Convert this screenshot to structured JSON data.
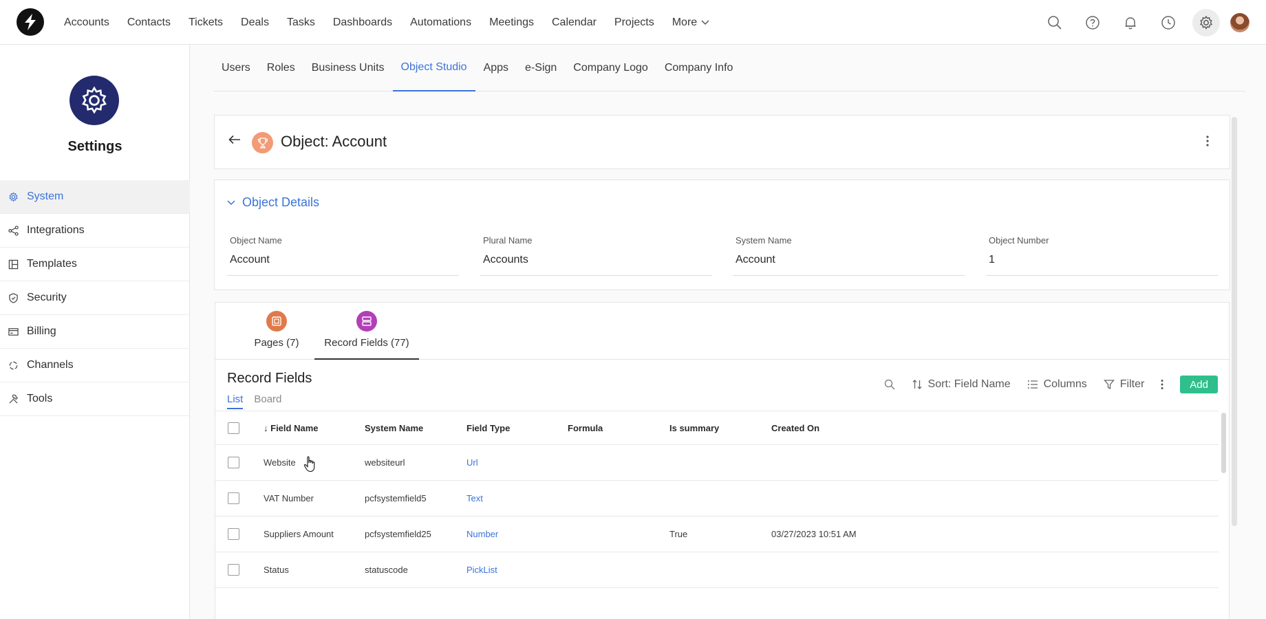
{
  "topnav": {
    "items": [
      "Accounts",
      "Contacts",
      "Tickets",
      "Deals",
      "Tasks",
      "Dashboards",
      "Automations",
      "Meetings",
      "Calendar",
      "Projects"
    ],
    "more_label": "More"
  },
  "sidebar": {
    "title": "Settings",
    "items": [
      {
        "label": "System",
        "icon": "gear-icon",
        "active": true
      },
      {
        "label": "Integrations",
        "icon": "share-icon"
      },
      {
        "label": "Templates",
        "icon": "layout-icon"
      },
      {
        "label": "Security",
        "icon": "shield-icon"
      },
      {
        "label": "Billing",
        "icon": "credit-card-icon"
      },
      {
        "label": "Channels",
        "icon": "channels-icon"
      },
      {
        "label": "Tools",
        "icon": "tools-icon"
      }
    ]
  },
  "main_tabs": [
    "Users",
    "Roles",
    "Business Units",
    "Object Studio",
    "Apps",
    "e-Sign",
    "Company Logo",
    "Company Info"
  ],
  "active_main_tab": "Object Studio",
  "object": {
    "title": "Object: Account",
    "details_heading": "Object Details",
    "fields": [
      {
        "label": "Object Name",
        "value": "Account"
      },
      {
        "label": "Plural Name",
        "value": "Accounts"
      },
      {
        "label": "System Name",
        "value": "Account"
      },
      {
        "label": "Object Number",
        "value": "1"
      }
    ]
  },
  "record_section": {
    "subtabs": [
      {
        "label": "Pages (7)",
        "color": "#e07a4a"
      },
      {
        "label": "Record Fields (77)",
        "color": "#b23fb8"
      }
    ],
    "title": "Record Fields",
    "views": [
      "List",
      "Board"
    ],
    "toolbar": {
      "sort": "Sort: Field Name",
      "columns": "Columns",
      "filter": "Filter",
      "add": "Add"
    },
    "columns": [
      "Field Name",
      "System Name",
      "Field Type",
      "Formula",
      "Is summary",
      "Created On"
    ],
    "rows": [
      {
        "name": "Website",
        "system": "websiteurl",
        "type": "Url",
        "formula": "",
        "summary": "",
        "created": ""
      },
      {
        "name": "VAT Number",
        "system": "pcfsystemfield5",
        "type": "Text",
        "formula": "",
        "summary": "",
        "created": ""
      },
      {
        "name": "Suppliers Amount",
        "system": "pcfsystemfield25",
        "type": "Number",
        "formula": "",
        "summary": "True",
        "created": "03/27/2023 10:51 AM"
      },
      {
        "name": "Status",
        "system": "statuscode",
        "type": "PickList",
        "formula": "",
        "summary": "",
        "created": ""
      }
    ]
  },
  "colors": {
    "accent": "#3b73d9",
    "add_button": "#2fbf8d",
    "settings_badge": "#232b6e",
    "object_icon": "#f29b76"
  }
}
